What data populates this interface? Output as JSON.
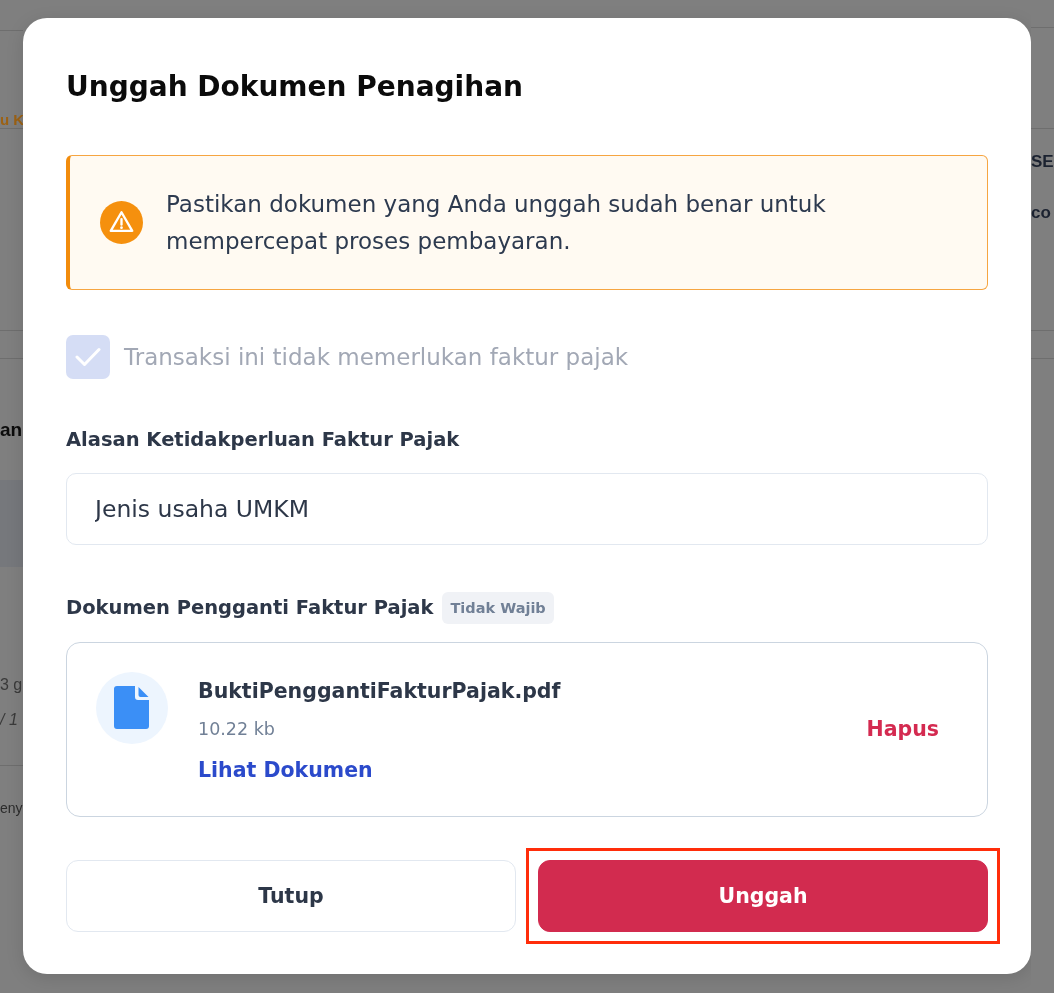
{
  "backdrop": {
    "left_fragments": [
      {
        "text": "u K",
        "kind": "link"
      },
      {
        "text": "an",
        "kind": "heading"
      },
      {
        "text": "3 g",
        "kind": "meta"
      },
      {
        "text": "/ 1",
        "kind": "meta_italic"
      },
      {
        "text": "eny",
        "kind": "body"
      }
    ],
    "right_fragments": [
      {
        "text": "SE",
        "kind": "label"
      },
      {
        "text": "co",
        "kind": "label"
      }
    ]
  },
  "dialog": {
    "title": "Unggah Dokumen Penagihan",
    "alert": {
      "kind": "warning",
      "text": "Pastikan dokumen yang Anda unggah sudah benar untuk mempercepat proses pembayaran."
    },
    "no_tax_invoice": {
      "label": "Transaksi ini tidak memerlukan faktur pajak",
      "checked": true,
      "disabled": true
    },
    "reason_field": {
      "label": "Alasan Ketidakperluan Faktur Pajak",
      "value": "Jenis usaha UMKM"
    },
    "replacement_document": {
      "label": "Dokumen Pengganti Faktur Pajak",
      "badge": "Tidak Wajib",
      "file": {
        "name": "BuktiPenggantiFakturPajak.pdf",
        "size": "10.22 kb",
        "view_link": "Lihat Dokumen",
        "remove_link": "Hapus"
      }
    },
    "buttons": [
      {
        "kind": "secondary",
        "label": "Tutup",
        "highlighted": false
      },
      {
        "kind": "primary",
        "label": "Unggah",
        "highlighted": true
      }
    ]
  }
}
